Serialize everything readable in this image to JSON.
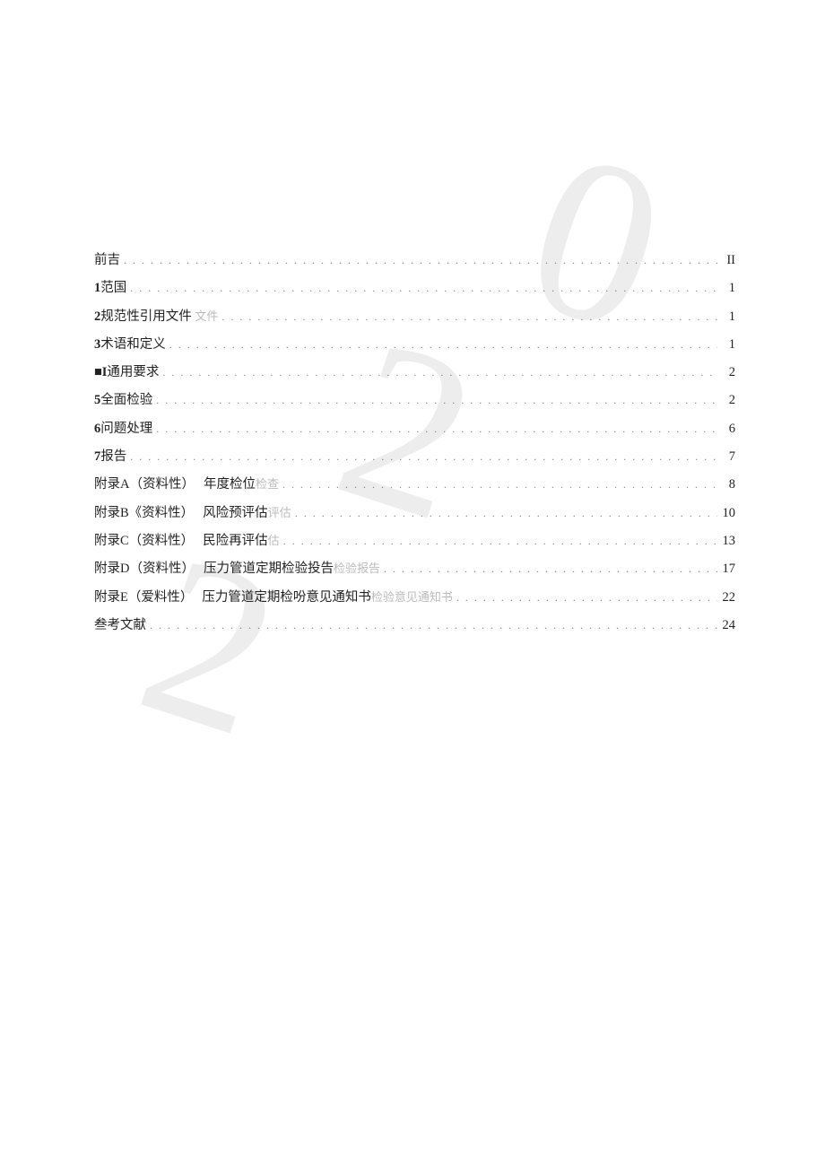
{
  "watermark": {
    "c1": "2",
    "c2": "0",
    "c3": "2"
  },
  "toc": [
    {
      "label": "前吉",
      "sub": "",
      "ghost": "",
      "page": "II"
    },
    {
      "label": "1范国",
      "sub": "",
      "ghost": "",
      "page": "1"
    },
    {
      "label": "2规范性引用文件",
      "sub": "",
      "ghost": "文件",
      "page": "1"
    },
    {
      "label": "3术语和定义",
      "sub": "",
      "ghost": "",
      "page": "1"
    },
    {
      "label": "■I通用要求",
      "sub": "",
      "ghost": "",
      "page": "2"
    },
    {
      "label": "5全面检验",
      "sub": "",
      "ghost": "",
      "page": "2"
    },
    {
      "label": "6问题处理",
      "sub": "",
      "ghost": "",
      "page": "6"
    },
    {
      "label": "7报告",
      "sub": "",
      "ghost": "",
      "page": "7"
    },
    {
      "label": "附录A（资料性）",
      "sub": "年度检位",
      "ghost": "检查",
      "page": "8"
    },
    {
      "label": "附录B《资料性）",
      "sub": "风险预评估",
      "ghost": "评估",
      "page": "10"
    },
    {
      "label": "附录C（资料性）",
      "sub": "民险再评估",
      "ghost": "估",
      "page": "13"
    },
    {
      "label": "附录D（资料性）",
      "sub": "压力管道定期检验投告",
      "ghost": "检验报告",
      "page": "17"
    },
    {
      "label": "附录E（爱料性）",
      "sub": "压力管道定期检吩意见通知书",
      "ghost": "检验意见通知书",
      "page": "22"
    },
    {
      "label": "叁考文献",
      "sub": "",
      "ghost": "",
      "page": "24"
    }
  ]
}
